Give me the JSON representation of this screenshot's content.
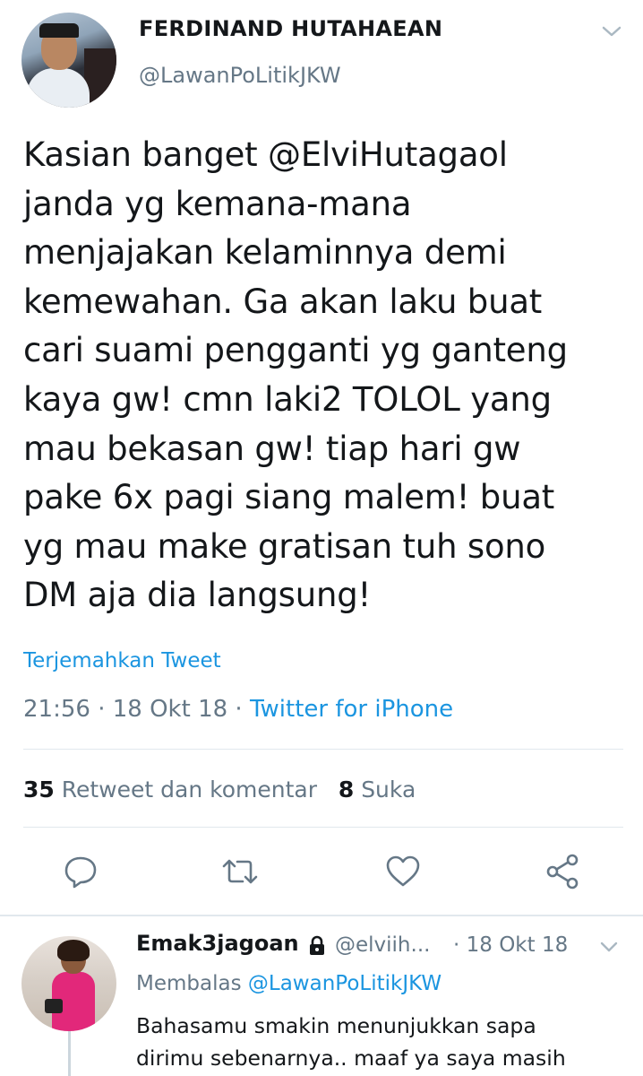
{
  "tweet": {
    "author_name": "FERDINAND HUTAHAEAN",
    "author_handle": "@LawanPoLitikJKW",
    "text": "Kasian banget @ElviHutagaol\njanda yg kemana-mana\nmenjajakan kelaminnya demi\nkemewahan. Ga akan laku buat\ncari suami pengganti yg ganteng\nkaya gw! cmn laki2 TOLOL yang\nmau bekasan gw! tiap hari gw\npake 6x pagi siang malem! buat\nyg mau make gratisan tuh sono\nDM aja dia langsung!",
    "translate_label": "Terjemahkan Tweet",
    "time": "21:56",
    "date": "18 Okt 18",
    "separator": " · ",
    "source": "Twitter for iPhone",
    "retweet_count": "35",
    "retweet_label": "Retweet dan komentar",
    "like_count": "8",
    "like_label": "Suka",
    "actions": [
      "reply-icon",
      "retweet-icon",
      "like-icon",
      "share-icon"
    ]
  },
  "reply": {
    "author_name": "Emak3jagoan",
    "author_handle": "@elviih...",
    "date": "· 18 Okt 18",
    "replying_prefix": "Membalas",
    "replying_to": "@LawanPoLitikJKW",
    "text": "Bahasamu smakin menunjukkan sapa\ndirimu sebenarnya.. maaf ya saya masih"
  },
  "colors": {
    "link": "#1b95e0",
    "secondary_text": "#657786",
    "divider": "#e1e8ed"
  }
}
